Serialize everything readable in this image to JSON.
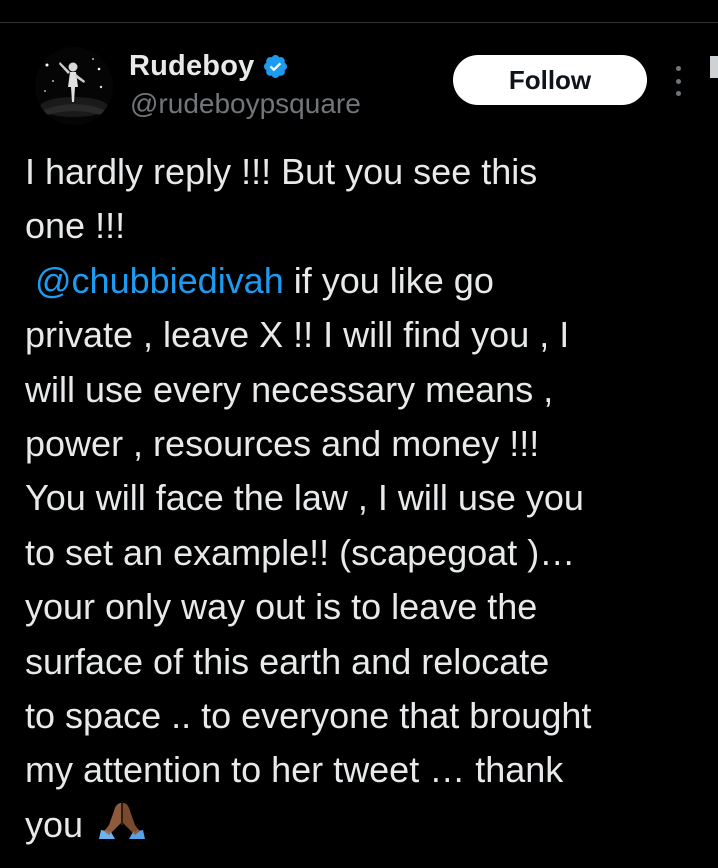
{
  "author": {
    "display_name": "Rudeboy",
    "handle": "@rudeboypsquare",
    "verified": true
  },
  "actions": {
    "follow_label": "Follow",
    "more_icon": "more-vertical-icon"
  },
  "tweet": {
    "line_1": "I hardly reply !!! But you see this",
    "line_2": "one !!!",
    "mention": "@chubbiedivah",
    "line_3_rest": " if you like go",
    "line_4": "private , leave X !! I will find you , I",
    "line_5": "will use every necessary means ,",
    "line_6": "power , resources and money !!!",
    "line_7": "You will face the law , I will use you",
    "line_8": "to set an example!! (scapegoat )…",
    "line_9": "your only way out is to leave the",
    "line_10": "surface of this earth and relocate",
    "line_11": "to space .. to everyone that brought",
    "line_12": "my attention to her tweet … thank",
    "line_13": "you",
    "emoji": "folded-hands-emoji"
  },
  "colors": {
    "background": "#000000",
    "text": "#e7e9ea",
    "secondary_text": "#71767b",
    "mention": "#1d9bf0",
    "verified_badge": "#1d9bf0"
  }
}
